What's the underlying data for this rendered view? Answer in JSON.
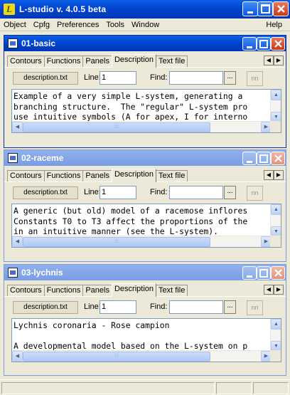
{
  "app": {
    "title": "L-studio v. 4.0.5 beta",
    "logo_letter": "L"
  },
  "menu": [
    "Object",
    "Cpfg",
    "Preferences",
    "Tools",
    "Window"
  ],
  "menu_help": "Help",
  "tabs": [
    "Contours",
    "Functions",
    "Panels",
    "Description",
    "Text file"
  ],
  "labels": {
    "line": "Line:",
    "find": "Find:",
    "browse": "...",
    "find_icon": "nn"
  },
  "windows": [
    {
      "title": "01-basic",
      "active": true,
      "file": "description.txt",
      "line": "1",
      "find": "",
      "text": "Example of a very simple L-system, generating a\nbranching structure.  The \"regular\" L-system pro\nuse intuitive symbols (A for apex, I for interno"
    },
    {
      "title": "02-raceme",
      "active": false,
      "file": "description.txt",
      "line": "1",
      "find": "",
      "text": "A generic (but old) model of a racemose inflores\nConstants T0 to T3 affect the proportions of the\nin an intuitive manner (see the L-system)."
    },
    {
      "title": "03-lychnis",
      "active": false,
      "file": "description.txt",
      "line": "1",
      "find": "",
      "text": "Lychnis coronaria - Rose campion\n\nA developmental model based on the L-system on p"
    }
  ],
  "colors": {
    "titlebar": "#0146cf",
    "inactive_title": "#7a9de4",
    "close": "#c93a18",
    "face": "#ece9d8"
  }
}
